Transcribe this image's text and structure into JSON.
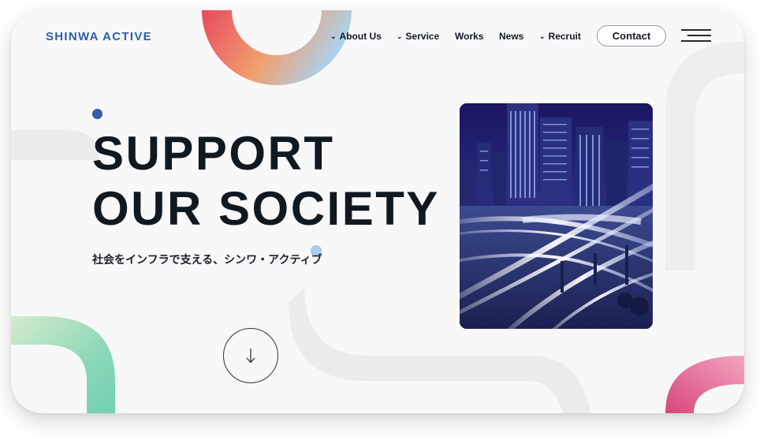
{
  "header": {
    "logo": "SHINWA ACTIVE",
    "nav": [
      {
        "label": "About Us",
        "has_dropdown": true
      },
      {
        "label": "Service",
        "has_dropdown": true
      },
      {
        "label": "Works",
        "has_dropdown": false
      },
      {
        "label": "News",
        "has_dropdown": false
      },
      {
        "label": "Recruit",
        "has_dropdown": true
      }
    ],
    "dropdown_icon": "chevron-down-icon",
    "contact_label": "Contact",
    "menu_icon": "hamburger-menu-icon"
  },
  "hero": {
    "headline_line1": "SUPPORT",
    "headline_line2": "OUR SOCIETY",
    "subcopy": "社会をインフラで支える、シンワ・アクティブ",
    "scroll_icon": "arrow-down-icon",
    "image": "night-city-highway-interchange"
  },
  "colors": {
    "brand_blue": "#2b5fa8",
    "text_dark": "#101820",
    "accent_dot_light": "#a9cbee",
    "ring_gradient": [
      "#e84a5f",
      "#f0a070",
      "#a8d4f0"
    ],
    "green_gradient": [
      "#cfe8c8",
      "#7ed3b8"
    ],
    "pink_gradient": [
      "#d94a7a",
      "#ee99b8"
    ]
  }
}
